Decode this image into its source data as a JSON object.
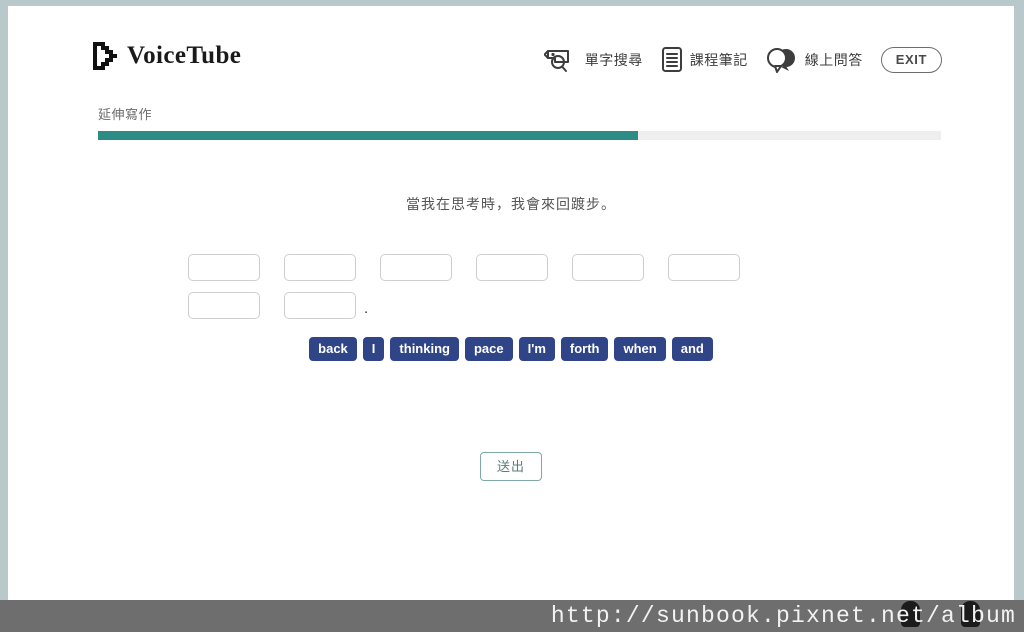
{
  "brand": {
    "name": "VoiceTube",
    "logo_icon": "play-triangle-icon"
  },
  "header": {
    "tools": [
      {
        "icon": "word-search-tag-icon",
        "label": "單字搜尋"
      },
      {
        "icon": "course-notes-document-icon",
        "label": "課程筆記"
      },
      {
        "icon": "speech-bubbles-icon",
        "label": "線上問答"
      }
    ],
    "exit_label": "EXIT"
  },
  "progress": {
    "label": "延伸寫作",
    "percent": 64,
    "fill_color": "#2e8c87",
    "track_color": "#eeeeee"
  },
  "exercise": {
    "prompt": "當我在思考時，我會來回踱步。",
    "slot_rows": [
      {
        "slots": [
          72,
          72,
          72,
          72,
          72,
          72
        ],
        "trailing_punctuation": ""
      },
      {
        "slots": [
          72,
          72
        ],
        "trailing_punctuation": "."
      }
    ],
    "word_bank": [
      "back",
      "I",
      "thinking",
      "pace",
      "I'm",
      "forth",
      "when",
      "and"
    ],
    "chip_color": "#2f4587",
    "submit_label": "送出",
    "submit_border_color": "#7fa9a6"
  },
  "watermark": {
    "url": "http://sunbook.pixnet.net/album"
  }
}
